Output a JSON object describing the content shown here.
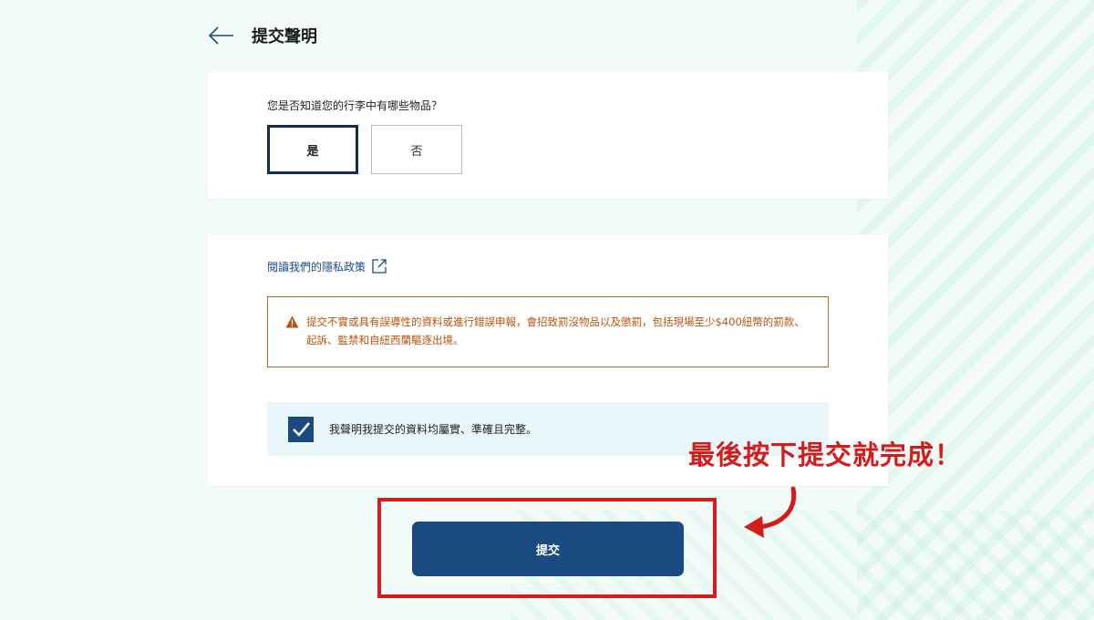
{
  "header": {
    "title": "提交聲明"
  },
  "question": {
    "label": "您是否知道您的行李中有哪些物品？",
    "options": [
      "是",
      "否"
    ],
    "selected": "是"
  },
  "privacy": {
    "link_text": "閱讀我們的隱私政策"
  },
  "warning": {
    "text": "提交不實或具有誤導性的資料或進行錯誤申報，會招致罰沒物品以及懲罰，包括現場至少$400紐幣的罰款、起訴、監禁和自紐西蘭驅逐出境。"
  },
  "declaration": {
    "text": "我聲明我提交的資料均屬實、準確且完整。",
    "checked": true
  },
  "submit": {
    "label": "提交"
  },
  "annotation": {
    "text": "最後按下提交就完成！"
  },
  "colors": {
    "primary": "#1a4a7f",
    "warning": "#c0671d",
    "annotation": "#d41c1c",
    "background": "#f2fbf8"
  },
  "icons": [
    "back-arrow-icon",
    "external-link-icon",
    "warning-icon",
    "check-icon",
    "annotation-arrow-icon"
  ]
}
